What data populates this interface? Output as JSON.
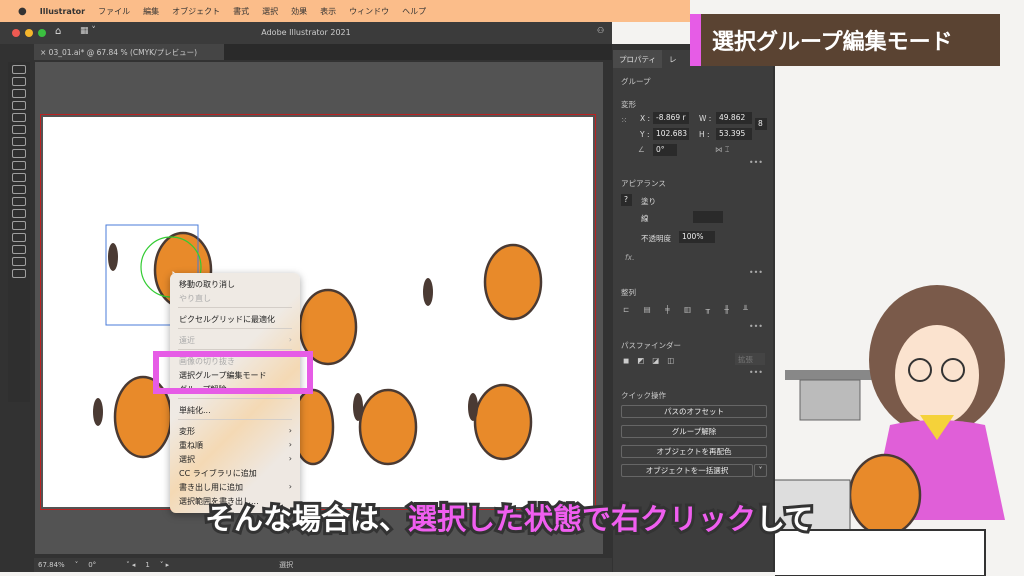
{
  "menubar": {
    "app": "Illustrator",
    "items": [
      "ファイル",
      "編集",
      "オブジェクト",
      "書式",
      "選択",
      "効果",
      "表示",
      "ウィンドウ",
      "ヘルプ"
    ]
  },
  "window": {
    "title": "Adobe Illustrator 2021",
    "doc_tab": "× 03_01.ai* @ 67.84 % (CMYK/プレビュー)"
  },
  "panel": {
    "tabs": [
      "プロパティ",
      "レ"
    ],
    "kind": "グループ",
    "transform": {
      "label": "変形",
      "x_label": "X :",
      "x": "-8.869 r",
      "y_label": "Y :",
      "y": "102.683",
      "w_label": "W :",
      "w": "49.862",
      "h_label": "H :",
      "h": "53.395",
      "angle": "0°"
    },
    "appearance": {
      "label": "アピアランス",
      "fill": "塗り",
      "stroke": "線",
      "opacity_label": "不透明度",
      "opacity": "100%",
      "fx": "fx."
    },
    "align": {
      "label": "整列"
    },
    "pathfinder": {
      "label": "パスファインダー",
      "expand": "拡張"
    },
    "quick": {
      "label": "クイック操作",
      "buttons": [
        "パスのオフセット",
        "グループ解除",
        "オブジェクトを再配色",
        "オブジェクトを一括選択"
      ]
    }
  },
  "context_menu": {
    "items": [
      {
        "label": "移動の取り消し",
        "disabled": false
      },
      {
        "label": "やり直し",
        "disabled": true
      },
      {
        "label": "ピクセルグリッドに最適化",
        "disabled": false
      },
      {
        "label": "遠近",
        "disabled": true,
        "sub": true
      },
      {
        "label": "画像の切り抜き",
        "disabled": true
      },
      {
        "label": "選択グループ編集モード",
        "disabled": false
      },
      {
        "label": "グループ解除",
        "disabled": false
      },
      {
        "label": "単純化...",
        "disabled": false
      },
      {
        "label": "変形",
        "sub": true
      },
      {
        "label": "重ね順",
        "sub": true
      },
      {
        "label": "選択",
        "sub": true
      },
      {
        "label": "CC ライブラリに追加"
      },
      {
        "label": "書き出し用に追加",
        "sub": true
      },
      {
        "label": "選択範囲を書き出し..."
      }
    ]
  },
  "status": {
    "zoom": "67.84%",
    "rotation": "0°",
    "page": "1",
    "tool": "選択"
  },
  "banner": "選択グループ編集モード",
  "subtitle": {
    "pre": "そんな場合は、",
    "highlight": "選択した状態で右クリック",
    "post": "して"
  },
  "colors": {
    "menubar": "#fbbd8a",
    "highlight": "#e65ce6",
    "banner": "#5a4332",
    "cat": "#e88a2a"
  }
}
